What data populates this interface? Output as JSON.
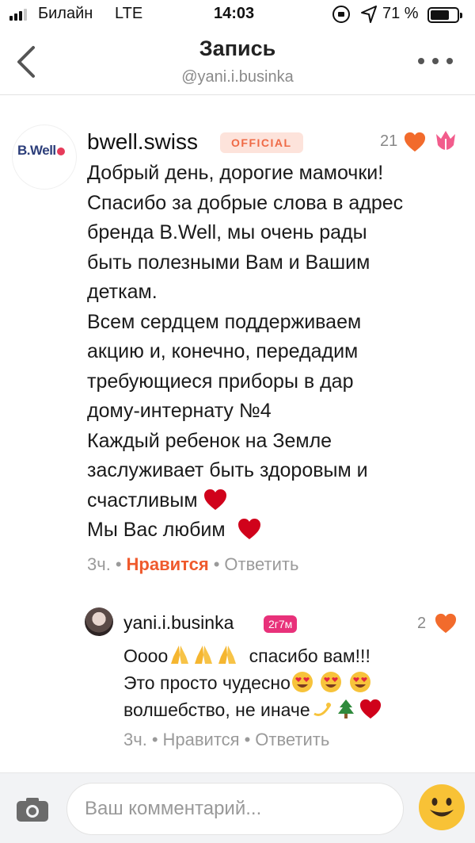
{
  "status_bar": {
    "carrier": "Билайн",
    "network": "LTE",
    "time": "14:03",
    "battery_percent": "71 %",
    "battery_level": 0.71,
    "signal_bars_active": 3,
    "signal_bars_total": 4
  },
  "header": {
    "title": "Запись",
    "subtitle": "@yani.i.businka"
  },
  "comment": {
    "brand_logo": "B.Well",
    "author": "bwell.swiss",
    "badge": "OFFICIAL",
    "likes": "21",
    "lines": [
      "Добрый день, дорогие мамочки!",
      "Спасибо за добрые слова в адрес",
      "бренда B.Well, мы очень рады",
      "быть полезными Вам и Вашим",
      "деткам.",
      "Всем сердцем поддерживаем",
      "акцию и, конечно, передадим",
      "требующиеся приборы в дар",
      "дому-интернату №4",
      "Каждый ребенок на Земле",
      "заслуживает быть здоровым и",
      "счастливым",
      "Мы Вас любим"
    ],
    "time": "3ч.",
    "like_label": "Нравится",
    "reply_label": "Ответить"
  },
  "reply": {
    "author": "yani.i.businka",
    "badge": "2г7м",
    "likes": "2",
    "line1_text": "Оооо",
    "line1_suffix": "спасибо вам!!!",
    "line2_text": "Это просто чудесно",
    "line3_text": "волшебство, не иначе",
    "time": "3ч.",
    "like_label": "Нравится",
    "reply_label": "Ответить"
  },
  "composer": {
    "placeholder": "Ваш комментарий..."
  },
  "colors": {
    "accent": "#ef5a2d",
    "official_badge_bg": "#fde3db",
    "official_badge_text": "#ef6a46",
    "level_badge_bg": "#e8317a",
    "heart_red": "#d0021b"
  },
  "icons": [
    "back-icon",
    "more-icon",
    "heart-icon",
    "tulip-icon",
    "camera-icon",
    "smile-icon",
    "pray-emoji",
    "heart-eyes-emoji",
    "sparkle-emoji",
    "tree-emoji"
  ]
}
